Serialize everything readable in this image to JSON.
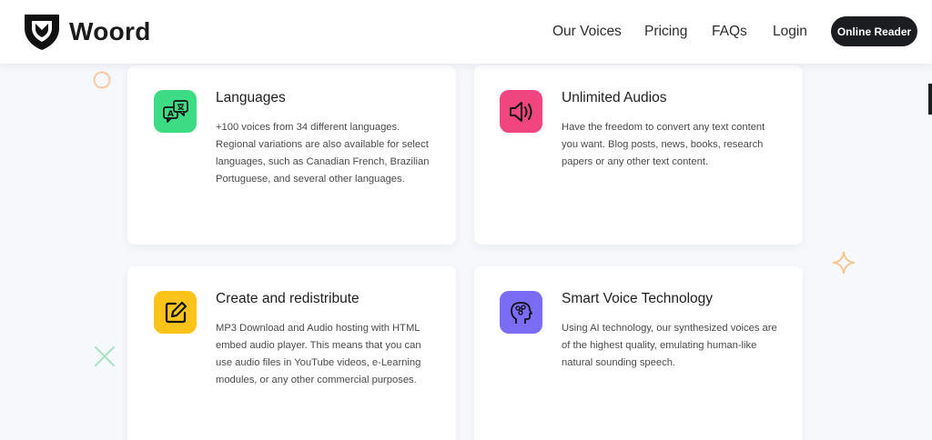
{
  "brand": {
    "name": "Woord"
  },
  "nav": {
    "items": [
      "Our Voices",
      "Pricing",
      "FAQs",
      "Login"
    ],
    "cta": "Online Reader"
  },
  "features": [
    {
      "icon": "translate-icon",
      "icon_color": "#3ddc84",
      "title": "Languages",
      "description": "+100 voices from 34 different languages. Regional variations are also available for select languages, such as Canadian French, Brazilian Portuguese, and several other languages."
    },
    {
      "icon": "speaker-icon",
      "icon_color": "#f0457f",
      "title": "Unlimited Audios",
      "description": "Have the freedom to convert any text content you want. Blog posts, news, books, research papers or any other text content."
    },
    {
      "icon": "edit-icon",
      "icon_color": "#fcc419",
      "title": "Create and redistribute",
      "description": "MP3 Download and Audio hosting with HTML embed audio player. This means that you can use audio files in YouTube videos, e-Learning modules, or any other commercial purposes."
    },
    {
      "icon": "ai-head-icon",
      "icon_color": "#7b6cf6",
      "title": "Smart Voice Technology",
      "description": "Using AI technology, our synthesized voices are of the highest quality, emulating human-like natural sounding speech."
    }
  ],
  "colors": {
    "cta_bg": "#1c1d20",
    "page_bg": "#f6f8fc",
    "deco_circle": "#f7c9a5",
    "deco_diamond": "#f5c48a",
    "deco_cross": "#a8e3c4"
  }
}
